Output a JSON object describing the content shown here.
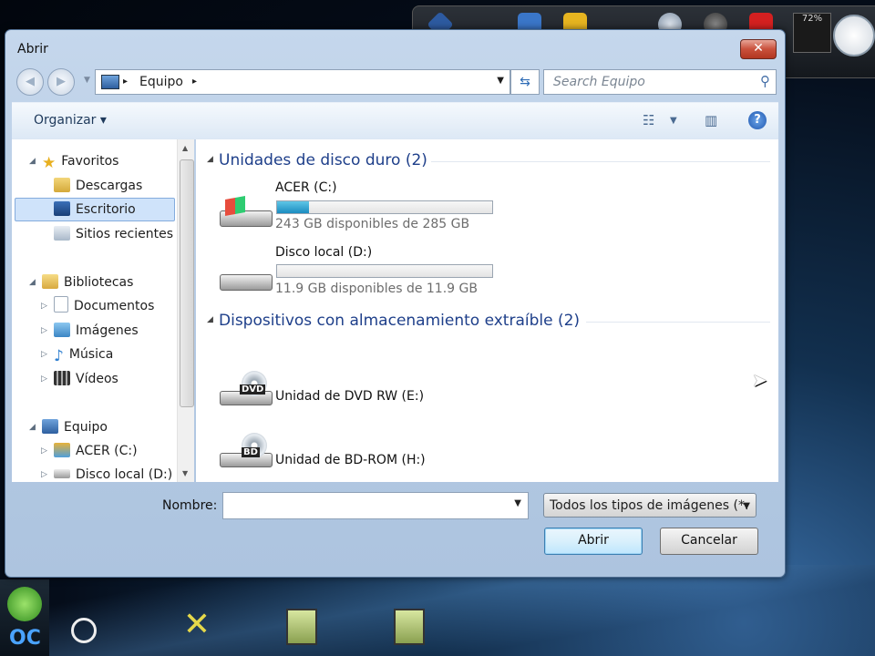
{
  "window": {
    "title": "Abrir",
    "close_glyph": "✕"
  },
  "address": {
    "crumbs": [
      "Equipo"
    ],
    "separator": "▸"
  },
  "search": {
    "placeholder": "Search Equipo"
  },
  "toolbar": {
    "organize_label": "Organizar ▾"
  },
  "nav": {
    "favorites": {
      "label": "Favoritos",
      "items": [
        "Descargas",
        "Escritorio",
        "Sitios recientes"
      ],
      "selected": "Escritorio"
    },
    "libraries": {
      "label": "Bibliotecas",
      "items": [
        "Documentos",
        "Imágenes",
        "Música",
        "Vídeos"
      ]
    },
    "computer": {
      "label": "Equipo",
      "items": [
        "ACER (C:)",
        "Disco local (D:)"
      ]
    }
  },
  "content": {
    "groups": [
      {
        "title": "Unidades de disco duro (2)",
        "drives": [
          {
            "name": "ACER (C:)",
            "free_text": "243 GB disponibles de 285 GB",
            "used_fraction": 0.15
          },
          {
            "name": "Disco local (D:)",
            "free_text": "11.9 GB disponibles de 11.9 GB",
            "used_fraction": 0.0
          }
        ]
      },
      {
        "title": "Dispositivos con almacenamiento extraíble (2)",
        "devices": [
          {
            "name": "Unidad de DVD RW (E:)",
            "badge": "DVD"
          },
          {
            "name": "Unidad de BD-ROM (H:)",
            "badge": "BD"
          }
        ]
      }
    ]
  },
  "footer": {
    "name_label": "Nombre:",
    "name_value": "",
    "filter_value": "Todos los tipos de imágenes (*.",
    "open_label": "Abrir",
    "cancel_label": "Cancelar"
  },
  "desktop": {
    "gadget_percent": "72%"
  },
  "colors": {
    "accent": "#1e3f8a",
    "selection": "#cfe3fa",
    "progress": "#1b8cc0"
  }
}
